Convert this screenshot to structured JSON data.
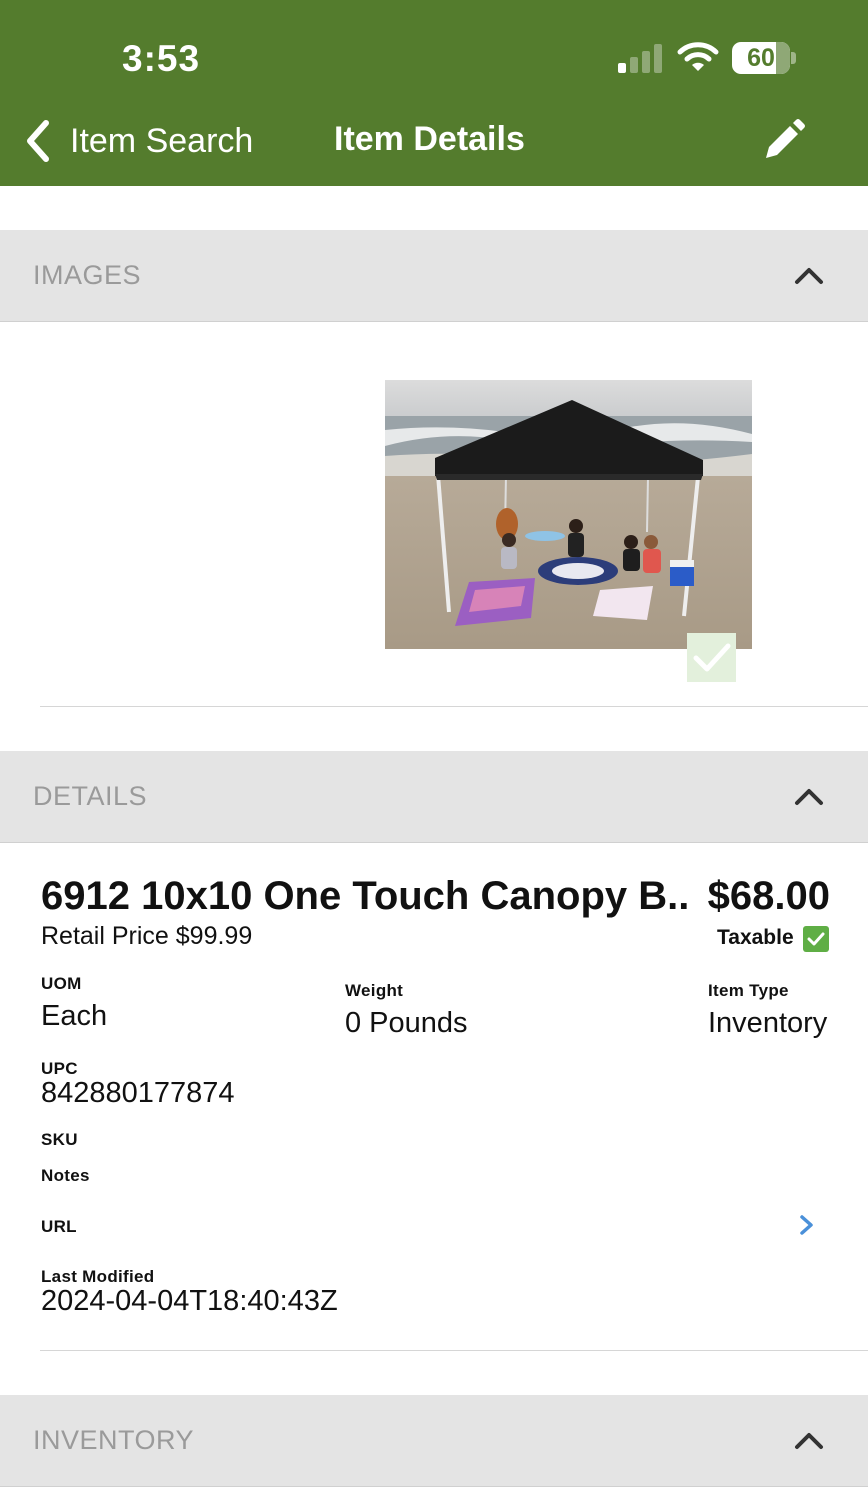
{
  "status_bar": {
    "time": "3:53",
    "battery": "60"
  },
  "nav": {
    "back_label": "Item Search",
    "title": "Item Details"
  },
  "colors": {
    "header": "#547c2d",
    "section_bg": "#e4e4e4",
    "check_green": "#5fae45",
    "link_blue": "#4a90d9"
  },
  "images_section": {
    "title": "IMAGES"
  },
  "details_section": {
    "title": "DETAILS",
    "item_name": "6912 10x10 One Touch Canopy B...",
    "price": "$68.00",
    "retail_price": "Retail Price $99.99",
    "taxable_label": "Taxable",
    "taxable": true,
    "uom_label": "UOM",
    "uom": "Each",
    "weight_label": "Weight",
    "weight": "0 Pounds",
    "item_type_label": "Item Type",
    "item_type": "Inventory",
    "upc_label": "UPC",
    "upc": "842880177874",
    "sku_label": "SKU",
    "notes_label": "Notes",
    "url_label": "URL",
    "last_modified_label": "Last Modified",
    "last_modified": "2024-04-04T18:40:43Z"
  },
  "inventory_section": {
    "title": "INVENTORY"
  },
  "icons": {
    "back": "chevron-left-icon",
    "edit": "pencil-icon",
    "toggle": "chevron-up-icon",
    "url": "chevron-right-icon",
    "check": "checkmark-icon"
  }
}
